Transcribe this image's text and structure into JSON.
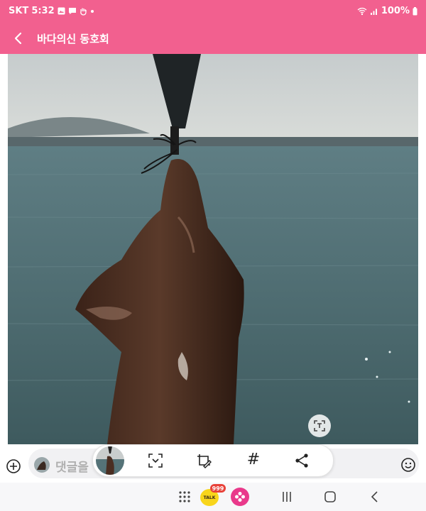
{
  "status_bar": {
    "carrier": "SKT",
    "time": "5:32",
    "battery": "100%",
    "icons": [
      "image-icon",
      "message-icon",
      "hand-icon",
      "dot-icon",
      "wifi-call-icon",
      "signal-icon",
      "battery-icon"
    ]
  },
  "app_bar": {
    "title": "바다의신 동호회",
    "back_icon": "chevron-left-icon",
    "color": "#f2608f"
  },
  "post": {
    "photo_icon": "text-scan-icon"
  },
  "comment": {
    "placeholder": "댓글을"
  },
  "toolbar": {
    "tools": [
      "scan-icon",
      "edit-crop-icon",
      "hashtag-icon",
      "share-icon"
    ],
    "hashtag_label": "#"
  },
  "nav_bar": {
    "talk_badge": "999",
    "talk_label": "TALK",
    "items": [
      "apps-grid-icon",
      "kakaotalk-icon",
      "flower-app-icon",
      "recents-icon",
      "home-icon",
      "back-icon"
    ]
  }
}
